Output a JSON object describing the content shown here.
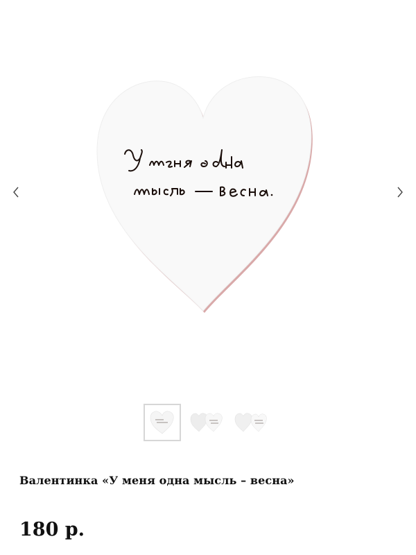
{
  "gallery": {
    "prev_icon": "chevron-left-icon",
    "next_icon": "chevron-right-icon",
    "main_image_icon": "heart-card-image",
    "thumbnails": [
      {
        "icon": "heart-card-thumb",
        "active": true
      },
      {
        "icon": "two-hearts-thumb",
        "active": false
      },
      {
        "icon": "two-hearts-thumb",
        "active": false
      }
    ]
  },
  "product": {
    "title": "Валентинка «У меня одна мысль – весна»",
    "price": "180 р."
  },
  "colors": {
    "background": "#ffffff",
    "card": "#f8f8f8",
    "card_edge": "#c98f8f",
    "ink": "#1a0e0a",
    "text": "#111111",
    "thumb_border": "#d6d6d6"
  }
}
